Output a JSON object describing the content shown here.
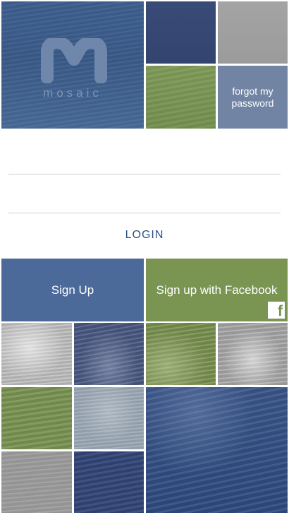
{
  "app": {
    "brand_name": "mosaic",
    "logo_letter": "M"
  },
  "links": {
    "forgot_password": "forgot my password"
  },
  "form": {
    "username_value": "",
    "username_placeholder": "",
    "password_value": "",
    "password_placeholder": ""
  },
  "buttons": {
    "login": "LOGIN",
    "sign_up": "Sign Up",
    "sign_up_facebook": "Sign up with Facebook",
    "facebook_glyph": "f"
  },
  "colors": {
    "brand_blue": "#3d5f8e",
    "navy": "#384a76",
    "green": "#7a9452",
    "slate": "#7184a4",
    "gray": "#a4a4a4",
    "login_text": "#2f4e86"
  },
  "icons": {
    "logo": "mosaic-m-logo-icon",
    "facebook": "facebook-icon"
  }
}
